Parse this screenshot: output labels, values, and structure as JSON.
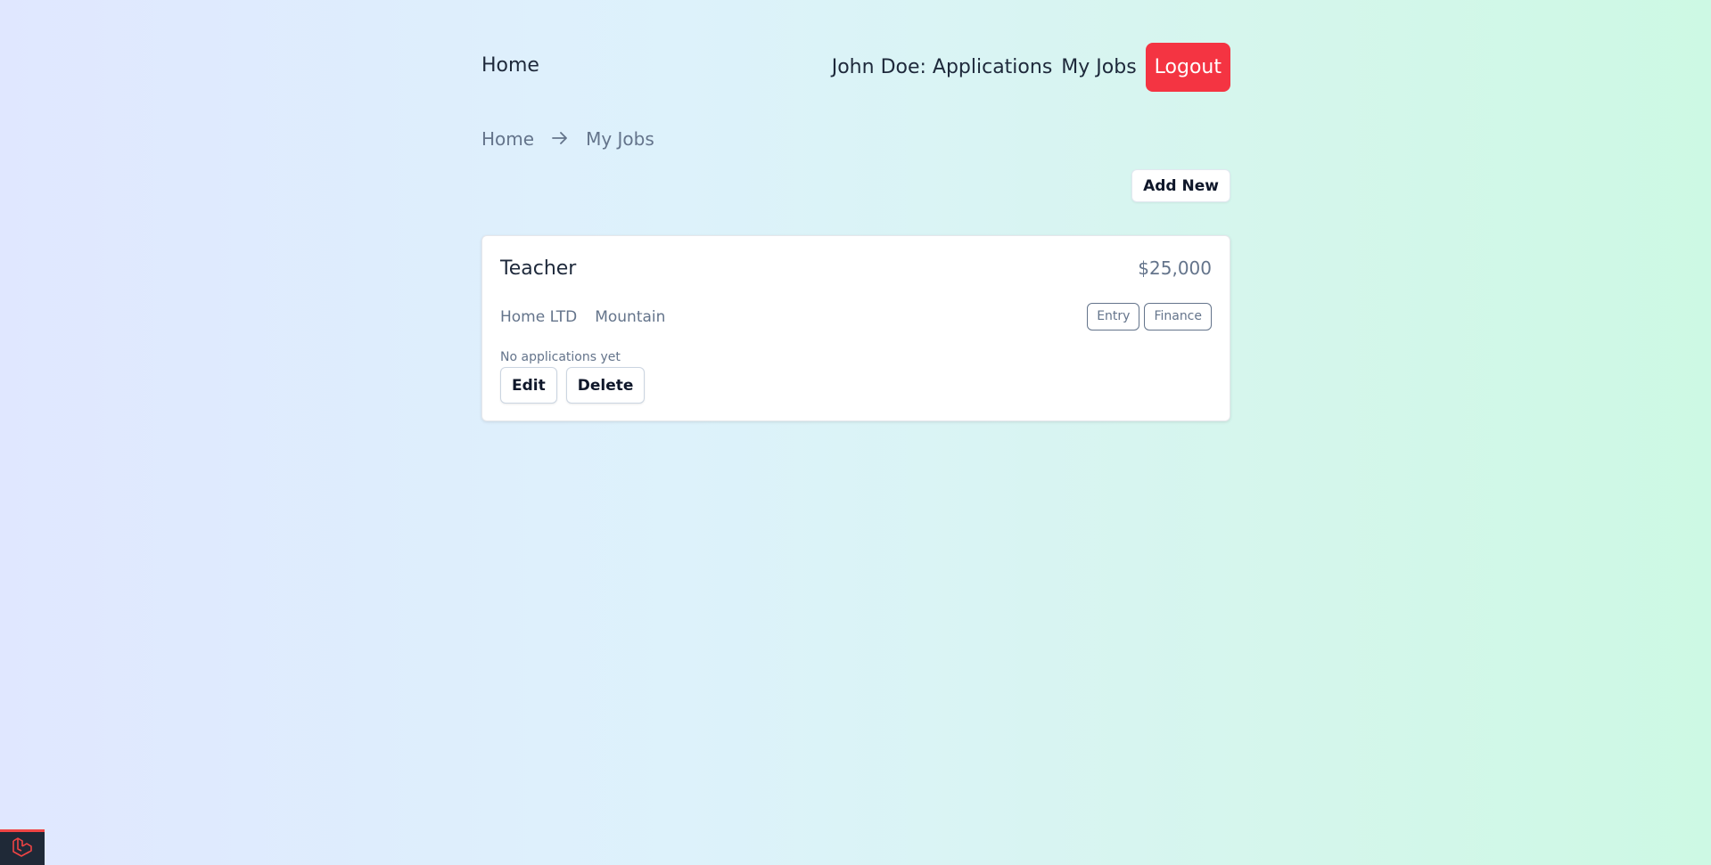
{
  "nav": {
    "home_label": "Home",
    "applications_label": "John Doe: Applications",
    "my_jobs_label": "My Jobs",
    "logout_label": "Logout"
  },
  "breadcrumb": {
    "items": [
      "Home",
      "My Jobs"
    ],
    "separator": "→"
  },
  "actions": {
    "add_new_label": "Add New"
  },
  "jobs": [
    {
      "title": "Teacher",
      "salary": "$25,000",
      "company": "Home LTD",
      "location": "Mountain",
      "tags": [
        "Entry",
        "Finance"
      ],
      "applications_text": "No applications yet",
      "edit_label": "Edit",
      "delete_label": "Delete"
    }
  ],
  "colors": {
    "accent_red": "#f43442",
    "text_dark": "#1e293b",
    "text_muted": "#64748b"
  },
  "icons": {
    "breadcrumb_separator": "arrow-right-icon",
    "debug_badge": "laravel-logo-icon"
  }
}
